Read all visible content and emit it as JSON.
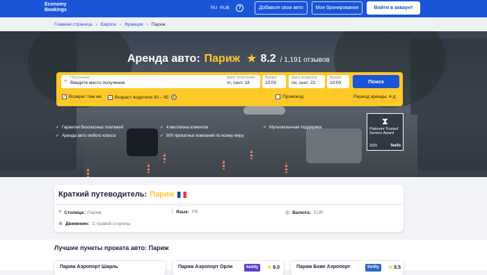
{
  "header": {
    "logo_line1": "Economy",
    "logo_line2": "Bookings",
    "lang": "RU",
    "currency": "RUB",
    "help_icon": "?",
    "add_car": "Добавьте свои авто",
    "my_booking": "Мое бронирование",
    "login": "Войти в аккаунт"
  },
  "breadcrumb": [
    "Главная страница",
    "Европа",
    "Франция",
    "Париж"
  ],
  "hero": {
    "title_prefix": "Аренда авто:",
    "city": "Париж",
    "rating": "8.2",
    "reviews": "/ 1,191 отзывов"
  },
  "search": {
    "pickup_label": "Получение",
    "pickup_placeholder": "Введите место получения",
    "pickup_date_label": "Дата получения",
    "pickup_date": "чт, сент. 18",
    "pickup_time_label": "Время",
    "pickup_time": "10:00",
    "return_date_label": "Дата возврата",
    "return_date": "пн, сент. 22",
    "return_time_label": "Время",
    "return_time": "10:00",
    "button": "Поиск",
    "same_return": "Возврат там же",
    "driver_age": "Возраст водителя 30 – 65",
    "promo": "Промокод",
    "period": "Период аренды: 4 д."
  },
  "features": [
    "Гарантия безопасных платежей",
    "Аренда авто любого класса",
    "4 миллиона клиентов",
    "800 прокатных компаний по всему миру",
    "Мультиязычная поддержка"
  ],
  "award": {
    "text": "Platinum Trusted Service Award",
    "year": "2025",
    "brand": "feefo"
  },
  "guide": {
    "title_prefix": "Краткий путеводитель:",
    "city": "Париж",
    "capital_label": "Столица:",
    "capital_value": "Париж",
    "language_label": "Язык:",
    "language_value": "FR",
    "currency_label": "Валюта:",
    "currency_value": "EUR",
    "driving_label": "Движение:",
    "driving_value": "С правой стороны"
  },
  "locations": {
    "title": "Лучшие пункты проката авто: Париж",
    "cards": [
      {
        "name": "Париж Аэропорт Шарль",
        "brand": "",
        "rating": ""
      },
      {
        "name": "Париж Аэропорт Орли",
        "brand": "keddy",
        "rating": "8.0"
      },
      {
        "name": "Париж Бове Аэропорт",
        "brand": "thrifty",
        "rating": "8.5"
      }
    ]
  },
  "colors": {
    "primary": "#1a55d8",
    "accent": "#ffc928"
  }
}
